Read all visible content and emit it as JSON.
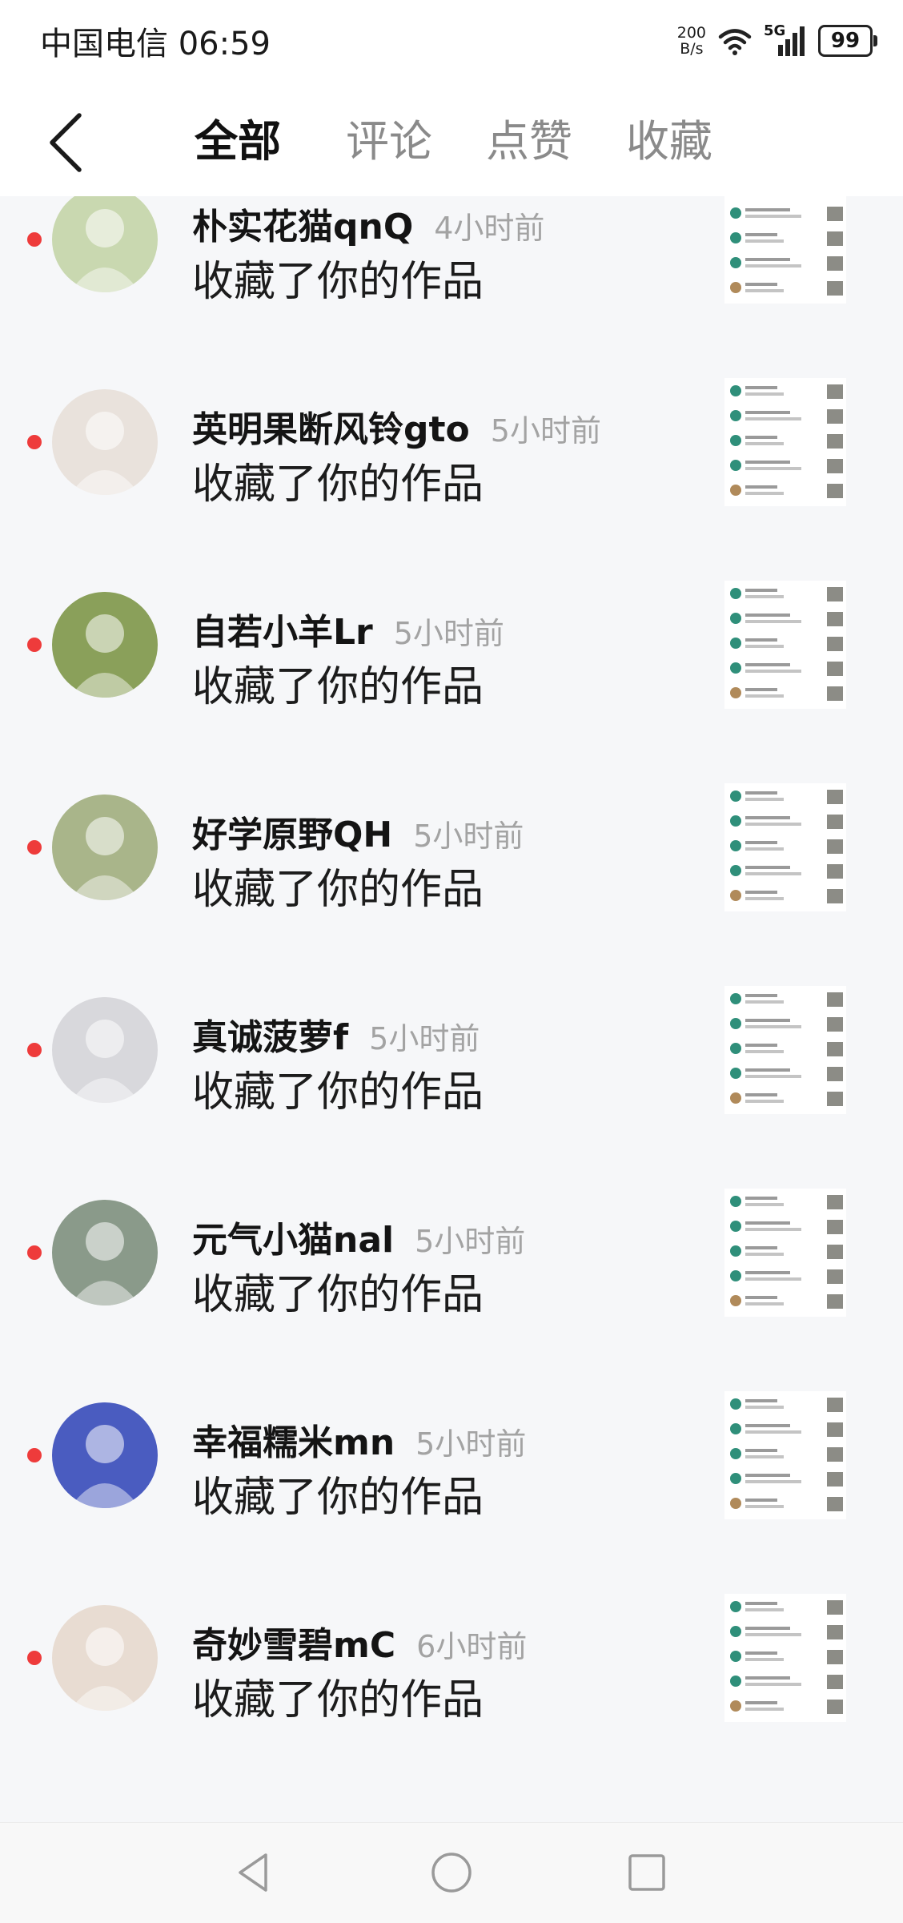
{
  "status": {
    "carrier_time": "中国电信 06:59",
    "speed_value": "200",
    "speed_unit": "B/s",
    "network": "5G",
    "battery": "99"
  },
  "header": {
    "tabs": [
      "全部",
      "评论",
      "点赞",
      "收藏"
    ],
    "active_tab": 0
  },
  "items": [
    {
      "name": "朴实花猫qnQ",
      "time": "4小时前",
      "action": "收藏了你的作品",
      "unread": true,
      "avatar_color": "#c9d8b0"
    },
    {
      "name": "英明果断风铃gto",
      "time": "5小时前",
      "action": "收藏了你的作品",
      "unread": true,
      "avatar_color": "#e9e2dc"
    },
    {
      "name": "自若小羊Lr",
      "time": "5小时前",
      "action": "收藏了你的作品",
      "unread": true,
      "avatar_color": "#8aa05a"
    },
    {
      "name": "好学原野QH",
      "time": "5小时前",
      "action": "收藏了你的作品",
      "unread": true,
      "avatar_color": "#a9b58a"
    },
    {
      "name": "真诚菠萝f",
      "time": "5小时前",
      "action": "收藏了你的作品",
      "unread": true,
      "avatar_color": "#d8d8dc"
    },
    {
      "name": "元气小猫nal",
      "time": "5小时前",
      "action": "收藏了你的作品",
      "unread": true,
      "avatar_color": "#8a9a8a"
    },
    {
      "name": "幸福糯米mn",
      "time": "5小时前",
      "action": "收藏了你的作品",
      "unread": true,
      "avatar_color": "#4a5cc0"
    },
    {
      "name": "奇妙雪碧mC",
      "time": "6小时前",
      "action": "收藏了你的作品",
      "unread": true,
      "avatar_color": "#e8dcd2"
    }
  ],
  "colors": {
    "accent_dot": "#ee3b3b",
    "muted": "#a3a3a3",
    "thumb_green": "#2f8f7a"
  }
}
